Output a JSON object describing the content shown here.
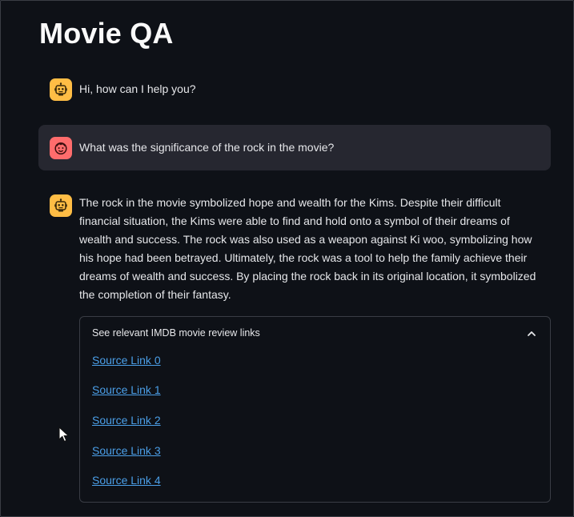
{
  "app": {
    "title": "Movie QA"
  },
  "messages": [
    {
      "role": "assistant",
      "avatar_icon": "bot-icon",
      "text": "Hi, how can I help you?"
    },
    {
      "role": "user",
      "avatar_icon": "smile-face-icon",
      "text": "What was the significance of the rock in the movie?"
    },
    {
      "role": "assistant",
      "avatar_icon": "bot-icon",
      "text": "The rock in the movie symbolized hope and wealth for the Kims. Despite their difficult financial situation, the Kims were able to find and hold onto a symbol of their dreams of wealth and success. The rock was also used as a weapon against Ki woo, symbolizing how his hope had been betrayed. Ultimately, the rock was a tool to help the family achieve their dreams of wealth and success. By placing the rock back in its original location, it symbolized the completion of their fantasy."
    }
  ],
  "expander": {
    "label": "See relevant IMDB movie review links",
    "expanded_icon": "chevron-up-icon",
    "links": [
      "Source Link 0",
      "Source Link 1",
      "Source Link 2",
      "Source Link 3",
      "Source Link 4"
    ]
  },
  "colors": {
    "background": "#0e1117",
    "user_bubble": "#262730",
    "bot_avatar": "#ffbd45",
    "user_avatar": "#ff6c6c",
    "link": "#4b9fe8"
  }
}
